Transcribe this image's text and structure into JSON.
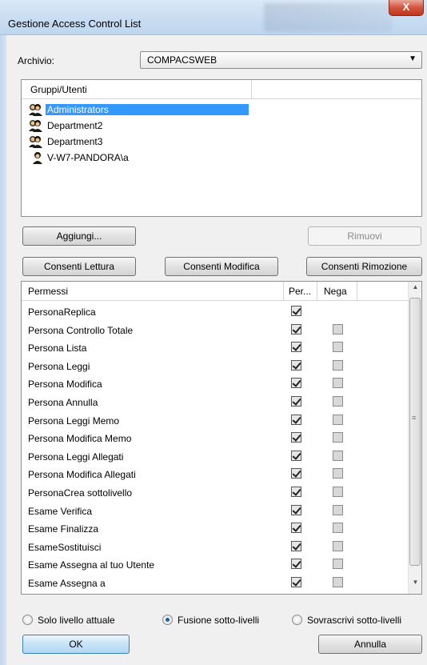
{
  "window": {
    "title": "Gestione Access Control List",
    "close_label": "X"
  },
  "archivio": {
    "label": "Archivio:",
    "value": "COMPACSWEB"
  },
  "users": {
    "column": "Gruppi/Utenti",
    "items": [
      {
        "name": "Administrators",
        "icon": "group-icon",
        "selected": true
      },
      {
        "name": "Department2",
        "icon": "group-icon",
        "selected": false
      },
      {
        "name": "Department3",
        "icon": "group-icon",
        "selected": false
      },
      {
        "name": "V-W7-PANDORA\\a",
        "icon": "user-icon",
        "selected": false
      }
    ]
  },
  "buttons": {
    "add": "Aggiungi...",
    "remove": "Rimuovi",
    "allow_read": "Consenti Lettura",
    "allow_modify": "Consenti Modifica",
    "allow_remove": "Consenti Rimozione",
    "ok": "OK",
    "cancel": "Annulla"
  },
  "permissions": {
    "columns": {
      "name": "Permessi",
      "allow": "Per...",
      "deny": "Nega"
    },
    "rows": [
      {
        "name": "PersonaReplica",
        "allow": true,
        "deny": null
      },
      {
        "name": "Persona Controllo Totale",
        "allow": true,
        "deny": false
      },
      {
        "name": "Persona Lista",
        "allow": true,
        "deny": false
      },
      {
        "name": "Persona Leggi",
        "allow": true,
        "deny": false
      },
      {
        "name": "Persona Modifica",
        "allow": true,
        "deny": false
      },
      {
        "name": "Persona Annulla",
        "allow": true,
        "deny": false
      },
      {
        "name": "Persona Leggi Memo",
        "allow": true,
        "deny": false
      },
      {
        "name": "Persona Modifica Memo",
        "allow": true,
        "deny": false
      },
      {
        "name": "Persona Leggi Allegati",
        "allow": true,
        "deny": false
      },
      {
        "name": "Persona Modifica Allegati",
        "allow": true,
        "deny": false
      },
      {
        "name": "PersonaCrea sottolivello",
        "allow": true,
        "deny": false
      },
      {
        "name": "Esame Verifica",
        "allow": true,
        "deny": false
      },
      {
        "name": "Esame Finalizza",
        "allow": true,
        "deny": false
      },
      {
        "name": "EsameSostituisci",
        "allow": true,
        "deny": false
      },
      {
        "name": "Esame Assegna al tuo Utente",
        "allow": true,
        "deny": false
      },
      {
        "name": "Esame Assegna a",
        "allow": true,
        "deny": false
      }
    ]
  },
  "options": [
    {
      "label": "Solo livello attuale",
      "checked": false
    },
    {
      "label": "Fusione sotto-livelli",
      "checked": true
    },
    {
      "label": "Sovrascrivi sotto-livelli",
      "checked": false
    }
  ]
}
